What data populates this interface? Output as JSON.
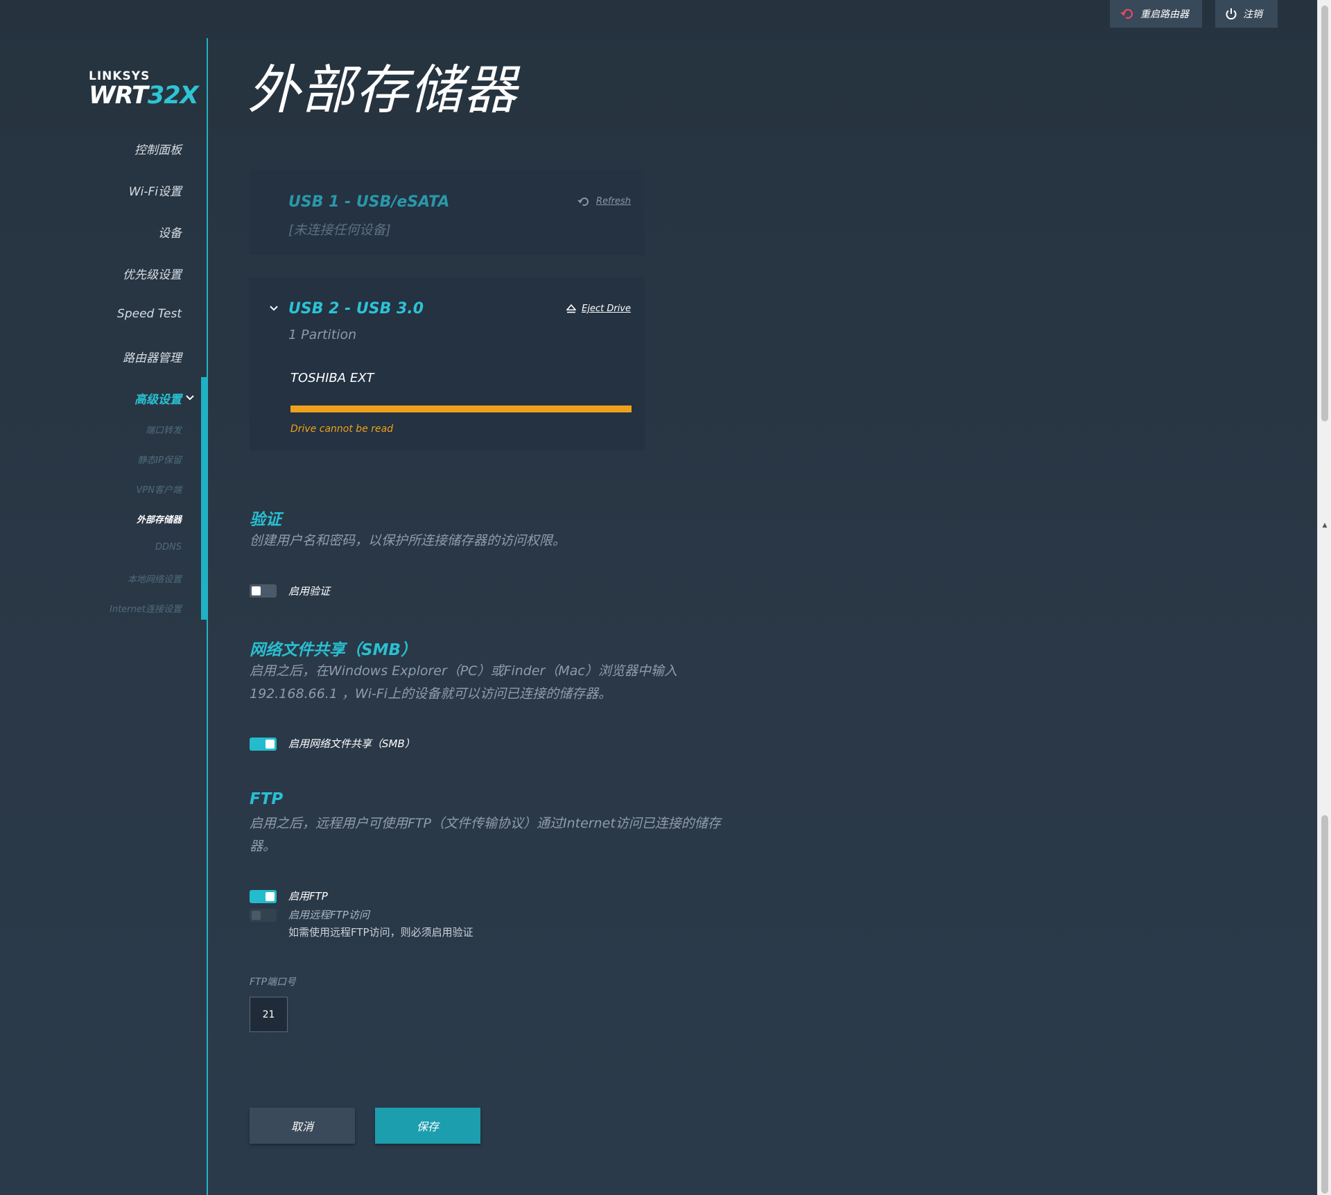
{
  "top_buttons": {
    "reboot_label": "重启路由器",
    "logout_label": "注销"
  },
  "logo": {
    "brand": "LINKSYS",
    "model_prefix": "WRT",
    "model_suffix": "32X"
  },
  "sidebar": {
    "items": [
      {
        "label": "控制面板"
      },
      {
        "label": "Wi-Fi设置"
      },
      {
        "label": "设备"
      },
      {
        "label": "优先级设置"
      },
      {
        "label": "Speed Test"
      },
      {
        "label": "路由器管理"
      },
      {
        "label": "高级设置"
      }
    ],
    "sub_items": [
      {
        "label": "端口转发"
      },
      {
        "label": "静态IP保留"
      },
      {
        "label": "VPN客户端"
      },
      {
        "label": "外部存储器"
      },
      {
        "label": "DDNS"
      },
      {
        "label": "本地网络设置"
      },
      {
        "label": "Internet连接设置"
      }
    ]
  },
  "page": {
    "title": "外部存储器"
  },
  "usb1": {
    "title": "USB 1 - USB/eSATA",
    "status": "[未连接任何设备]",
    "action_label": "Refresh"
  },
  "usb2": {
    "title": "USB 2 - USB 3.0",
    "partitions": "1 Partition",
    "action_label": "Eject Drive",
    "drive_name": "TOSHIBA EXT",
    "drive_status": "Drive cannot be read",
    "status_color": "#f0a11b"
  },
  "auth": {
    "title": "验证",
    "description": "创建用户名和密码，以保护所连接储存器的访问权限。",
    "toggle_label": "启用验证",
    "enabled": false
  },
  "smb": {
    "title": "网络文件共享（SMB）",
    "description_line1": "启用之后，在Windows Explorer（PC）或Finder（Mac）浏览器中输入",
    "description_line2": "192.168.66.1 ，Wi-Fi上的设备就可以访问已连接的储存器。",
    "toggle_label": "启用网络文件共享（SMB）",
    "enabled": true
  },
  "ftp": {
    "title": "FTP",
    "description_line1": "启用之后，远程用户可使用FTP（文件传输协议）通过Internet访问已连接的储存",
    "description_line2": "器。",
    "toggle_label": "启用FTP",
    "enabled": true,
    "remote_toggle_label": "启用远程FTP访问",
    "remote_enabled": false,
    "remote_hint": "如需使用远程FTP访问，则必须启用验证",
    "port_label": "FTP端口号",
    "port_value": "21"
  },
  "actions": {
    "cancel_label": "取消",
    "save_label": "保存"
  },
  "colors": {
    "accent": "#29bfd1",
    "background": "#2a3848",
    "card": "#243242",
    "warning": "#f0a11b"
  }
}
